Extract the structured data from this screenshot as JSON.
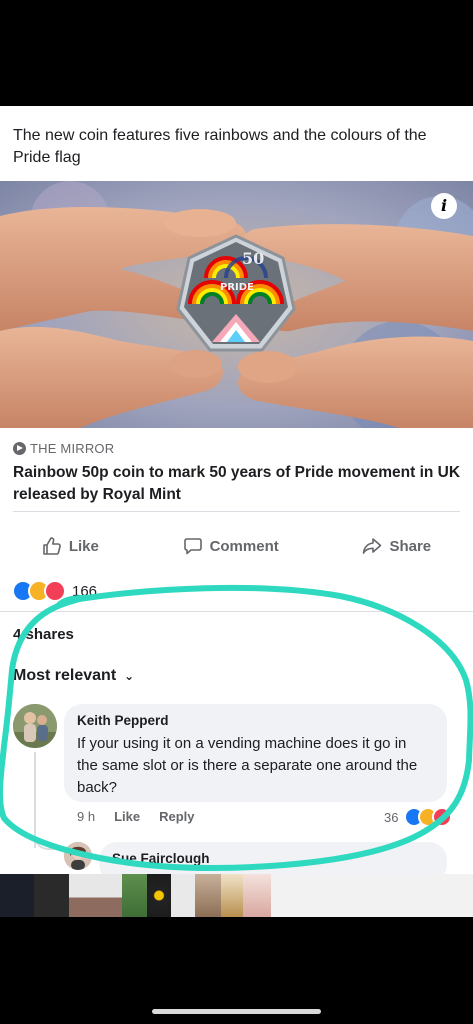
{
  "post": {
    "caption": "The new coin features five rainbows and the colours of the Pride flag",
    "link": {
      "source": "THE MIRROR",
      "headline": "Rainbow 50p coin to mark 50 years of Pride movement in UK released by Royal Mint"
    },
    "image": {
      "coin_value": "50",
      "coin_word": "PRIDE",
      "info_icon": "i"
    }
  },
  "actions": {
    "like": "Like",
    "comment": "Comment",
    "share": "Share"
  },
  "reactions": {
    "count": "166",
    "icons": [
      "like-icon",
      "haha-icon",
      "love-icon"
    ]
  },
  "shares": "4 shares",
  "comments_sort": "Most relevant",
  "comment": {
    "author": "Keith Pepperd",
    "text": "If your using it on a vending machine does it go in the same slot or is there a separate one around the back?",
    "time": "9 h",
    "like": "Like",
    "reply": "Reply",
    "reaction_count": "36"
  },
  "reply": {
    "author": "Sue Fairclough"
  },
  "colors": {
    "facebook_blue": "#1877f2",
    "annotation_teal": "#2fd9c0",
    "secondary_text": "#65676b",
    "bubble_bg": "#f0f2f5"
  }
}
